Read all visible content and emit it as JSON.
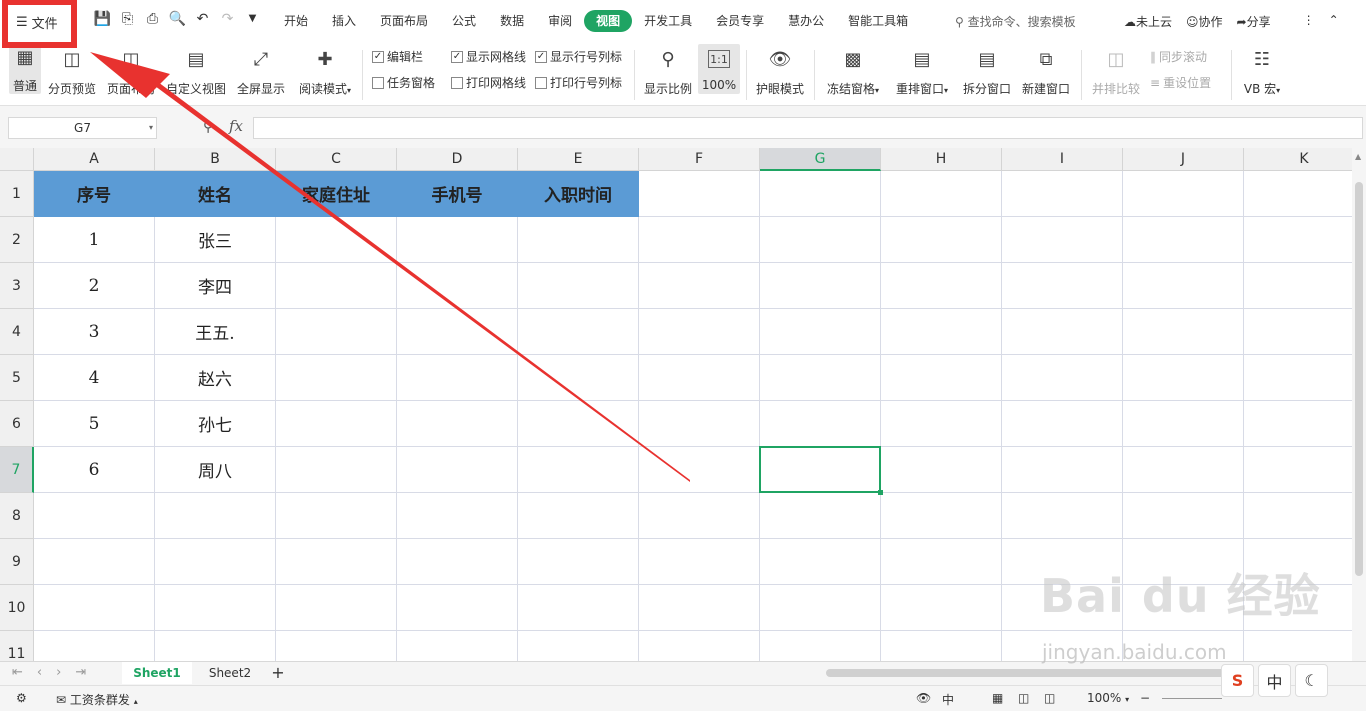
{
  "menubar": {
    "file_label": "文件",
    "tabs": [
      "开始",
      "插入",
      "页面布局",
      "公式",
      "数据",
      "审阅",
      "视图",
      "开发工具",
      "会员专享",
      "慧办公",
      "智能工具箱"
    ],
    "active_tab": "视图",
    "search_placeholder": "查找命令、搜索模板",
    "cloud": "未上云",
    "collab": "协作",
    "share": "分享"
  },
  "ribbon": {
    "normal": "普通",
    "page_preview": "分页预览",
    "page_layout": "页面布局",
    "custom_view": "自定义视图",
    "fullscreen": "全屏显示",
    "read_mode": "阅读模式",
    "edit_bar": "编辑栏",
    "task_pane": "任务窗格",
    "show_grid": "显示网格线",
    "print_grid": "打印网格线",
    "show_headers": "显示行号列标",
    "print_headers": "打印行号列标",
    "zoom_ratio": "显示比例",
    "zoom_100": "100%",
    "eye_mode": "护眼模式",
    "freeze": "冻结窗格",
    "arrange": "重排窗口",
    "split": "拆分窗口",
    "new_window": "新建窗口",
    "compare": "并排比较",
    "sync_scroll": "同步滚动",
    "reset_pos": "重设位置",
    "vb_macro": "VB 宏"
  },
  "formula": {
    "name_box": "G7",
    "fx": "fx",
    "value": ""
  },
  "columns": [
    "A",
    "B",
    "C",
    "D",
    "E",
    "F",
    "G",
    "H",
    "I",
    "J",
    "K"
  ],
  "rows": [
    "1",
    "2",
    "3",
    "4",
    "5",
    "6",
    "7",
    "8",
    "9",
    "10",
    "11"
  ],
  "table": {
    "headers": [
      "序号",
      "姓名",
      "家庭住址",
      "手机号",
      "入职时间"
    ],
    "rows": [
      [
        "1",
        "张三"
      ],
      [
        "2",
        "李四"
      ],
      [
        "3",
        "王五."
      ],
      [
        "4",
        "赵六"
      ],
      [
        "5",
        "孙七"
      ],
      [
        "6",
        "周八"
      ]
    ]
  },
  "sheets": {
    "tabs": [
      "Sheet1",
      "Sheet2"
    ],
    "active": "Sheet1"
  },
  "statusbar": {
    "payroll": "工资条群发",
    "zoom": "100%",
    "ime_lang": "中"
  },
  "watermark": {
    "logo_text": "Bai du 经验",
    "url": "jingyan.baidu.com"
  },
  "annotation": {
    "highlight_color": "#e8322f"
  }
}
